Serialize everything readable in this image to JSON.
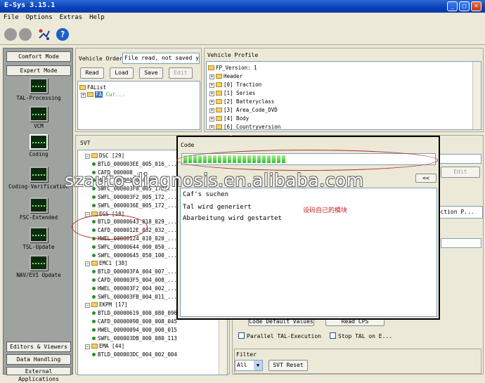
{
  "window": {
    "title": "E-Sys 3.15.1"
  },
  "menu": [
    "File",
    "Options",
    "Extras",
    "Help"
  ],
  "left": {
    "comfort_mode": "Comfort Mode",
    "expert_mode": "Expert Mode",
    "tools": [
      "TAL-Processing",
      "VCM",
      "Coding",
      "Coding-Verification",
      "FSC-Extended",
      "TSL-Update",
      "NAV/EVI Update"
    ],
    "editors_viewers": "Editors & Viewers",
    "data_handling": "Data Handling",
    "external_apps": "External Applications"
  },
  "vehicle_order": {
    "label": "Vehicle Order",
    "status": "File read, not saved yet.",
    "read": "Read",
    "load": "Load",
    "save": "Save",
    "edit": "Edit",
    "tree_root": "FAList",
    "tree_child": "FA",
    "tree_child_suffix": "Cur..."
  },
  "vehicle_profile": {
    "label": "Vehicle Profile",
    "root": "FP_Version: 1",
    "items": [
      "Header",
      "[0] Traction",
      "[1] Series",
      "[2] Batteryclass",
      "[3] Area_Code_DVD",
      "[4] Body",
      "[6] Countryversion"
    ]
  },
  "svt": {
    "label": "SVT",
    "rows": [
      {
        "kind": "folder",
        "text": "DSC [29]"
      },
      {
        "kind": "leaf",
        "text": "BTLD_000003EE_005_016_..."
      },
      {
        "kind": "leaf",
        "text": "CAFD_000008_..."
      },
      {
        "kind": "leaf",
        "text": "HWEL_000001_004_016_..."
      },
      {
        "kind": "leaf",
        "text": "SWFL_000003F0_005_172_..."
      },
      {
        "kind": "leaf",
        "text": "SWFL_000003F2_005_172_..."
      },
      {
        "kind": "leaf",
        "text": "SWFL_0000036E_005_172_..."
      },
      {
        "kind": "folder",
        "text": "EGS [18]"
      },
      {
        "kind": "leaf",
        "text": "BTLD_00000643_018_029_..."
      },
      {
        "kind": "leaf",
        "text": "CAFD_0000012E_032_032_..."
      },
      {
        "kind": "leaf",
        "text": "HWEL_00000124_010_020_..."
      },
      {
        "kind": "leaf",
        "text": "SWFL_00000644_000_050_..."
      },
      {
        "kind": "leaf",
        "text": "SWFL_00000645_050_100_..."
      },
      {
        "kind": "folder",
        "text": "EMC1 [38]"
      },
      {
        "kind": "leaf",
        "text": "BTLD_000003FA_004_007_..."
      },
      {
        "kind": "leaf",
        "text": "CAFD_000003F5_004_008_..."
      },
      {
        "kind": "leaf",
        "text": "HWEL_000003F2_004_002_..."
      },
      {
        "kind": "leaf",
        "text": "SWFL_000003FB_004_011_..."
      },
      {
        "kind": "folder",
        "text": "EKPM [17]"
      },
      {
        "kind": "leaf",
        "text": "BTLD_00000619_000_080_096"
      },
      {
        "kind": "leaf",
        "text": "CAFD_00000098_000_008_045"
      },
      {
        "kind": "leaf",
        "text": "HWEL_00000094_000_000_015"
      },
      {
        "kind": "leaf",
        "text": "SWFL_000003DB_000_080_113"
      },
      {
        "kind": "folder",
        "text": "EMA [44]"
      },
      {
        "kind": "leaf",
        "text": "BTLD_000003DC_004_002_004"
      }
    ]
  },
  "right_lower": {
    "edit": "Edit",
    "construction": "truction P...",
    "code_default": "Code Default Values",
    "read_cps": "Read CPS",
    "parallel": "Parallel TAL-Execution",
    "stop_tal": "Stop TAL on E...",
    "filter_label": "Filter",
    "filter_value": "All",
    "svt_reset": "SVT Reset"
  },
  "dialog": {
    "title": "Code",
    "progress": 0.42,
    "back_btn": "<<",
    "log": [
      "Caf's suchen",
      "Tal wird generiert",
      "Abarbeitung wird gestartet"
    ],
    "annotation": "设码自己的模块"
  },
  "watermark": "szauto-diagnosis.en.alibaba.com"
}
